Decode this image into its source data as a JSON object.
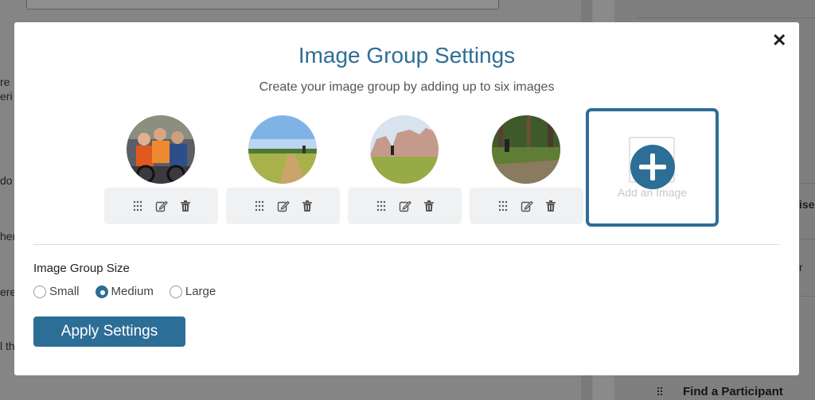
{
  "background": {
    "left_snippets": [
      "re",
      "eri",
      "do",
      "her",
      "ere",
      "l th"
    ],
    "right_snippets": [
      "ise",
      "r"
    ],
    "right_title": "Find a Participant"
  },
  "modal": {
    "title": "Image Group Settings",
    "subtitle": "Create your image group by adding up to six images",
    "close_label": "✕",
    "add_image_label": "Add an Image",
    "size_label": "Image Group Size",
    "size_options": [
      {
        "label": "Small",
        "checked": false
      },
      {
        "label": "Medium",
        "checked": true
      },
      {
        "label": "Large",
        "checked": false
      }
    ],
    "apply_label": "Apply Settings"
  },
  "colors": {
    "accent": "#2d6e96",
    "toolbar_bg": "#f0f1f3"
  },
  "icons": [
    "drag-handle-icon",
    "edit-icon",
    "trash-icon",
    "close-icon",
    "plus-icon"
  ]
}
